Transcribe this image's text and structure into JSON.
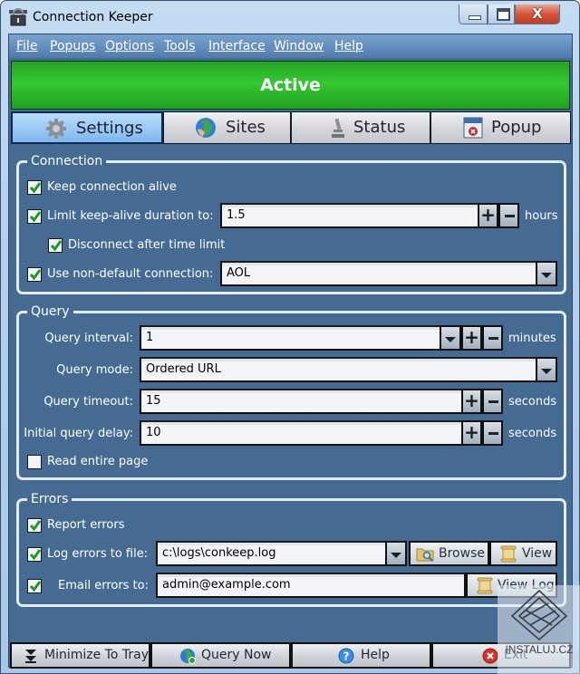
{
  "window": {
    "title": "Connection Keeper",
    "controls": {
      "minimize": "minimize",
      "maximize": "maximize",
      "close": "X"
    }
  },
  "menu": [
    "File",
    "Popups",
    "Options",
    "Tools",
    "Interface",
    "Window",
    "Help"
  ],
  "status": {
    "text": "Active",
    "color": "#33c832"
  },
  "tabs": [
    {
      "label": "Settings",
      "icon": "gear-icon",
      "active": true
    },
    {
      "label": "Sites",
      "icon": "globe-icon",
      "active": false
    },
    {
      "label": "Status",
      "icon": "microscope-icon",
      "active": false
    },
    {
      "label": "Popup",
      "icon": "popup-window-icon",
      "active": false
    }
  ],
  "connection": {
    "title": "Connection",
    "keep_alive": {
      "label": "Keep connection alive",
      "checked": true
    },
    "limit_duration": {
      "label": "Limit keep-alive duration to:",
      "checked": true,
      "value": "1.5",
      "unit": "hours"
    },
    "disconnect_after": {
      "label": "Disconnect after time limit",
      "checked": true
    },
    "non_default": {
      "label": "Use non-default connection:",
      "checked": true,
      "value": "AOL"
    }
  },
  "query": {
    "title": "Query",
    "interval": {
      "label": "Query interval:",
      "value": "1",
      "unit": "minutes"
    },
    "mode": {
      "label": "Query mode:",
      "value": "Ordered URL"
    },
    "timeout": {
      "label": "Query timeout:",
      "value": "15",
      "unit": "seconds"
    },
    "initial_delay": {
      "label": "Initial query delay:",
      "value": "10",
      "unit": "seconds"
    },
    "read_entire": {
      "label": "Read entire page",
      "checked": false
    }
  },
  "errors": {
    "title": "Errors",
    "report": {
      "label": "Report errors",
      "checked": true
    },
    "log_file": {
      "label": "Log errors to file:",
      "checked": true,
      "value": "c:\\logs\\conkeep.log",
      "browse": "Browse",
      "view": "View"
    },
    "email": {
      "label": "Email errors to:",
      "checked": true,
      "value": "admin@example.com",
      "view_log": "View Log"
    }
  },
  "bottom": {
    "minimize_tray": "Minimize To Tray",
    "query_now": "Query Now",
    "help": "Help",
    "exit": "Exit"
  },
  "watermark": "INSTALUJ.CZ"
}
